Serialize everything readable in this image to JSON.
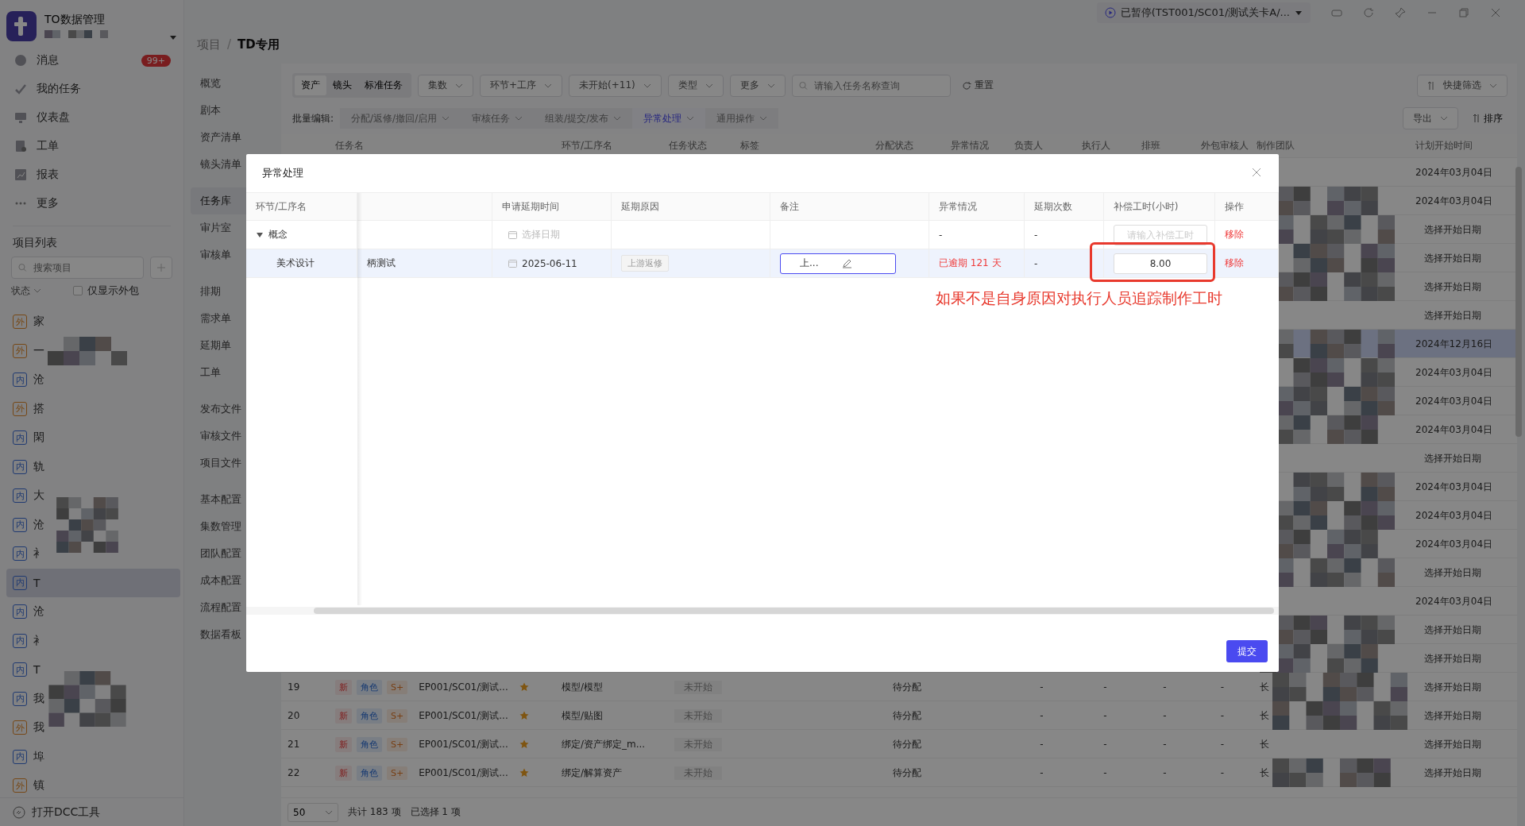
{
  "titlebar": {
    "status": "已暂停(TST001/SC01/测试关卡A/..."
  },
  "sidebar": {
    "app_name": "TO数据管理",
    "menu": [
      {
        "label": "消息",
        "badge": "99+"
      },
      {
        "label": "我的任务"
      },
      {
        "label": "仪表盘"
      },
      {
        "label": "工单"
      },
      {
        "label": "报表"
      },
      {
        "label": "更多"
      }
    ],
    "project_list": {
      "title": "项目列表",
      "search_placeholder": "搜索项目",
      "status_filter": "状态",
      "outsource_only": {
        "label": "仅显示外包",
        "checked": false
      },
      "projects": [
        {
          "tag": "外",
          "kind": "external",
          "name": "家",
          "selected": false
        },
        {
          "tag": "外",
          "kind": "external",
          "name": "一",
          "selected": false
        },
        {
          "tag": "内",
          "kind": "internal",
          "name": "沧",
          "selected": false
        },
        {
          "tag": "外",
          "kind": "external",
          "name": "搭",
          "selected": false
        },
        {
          "tag": "内",
          "kind": "internal",
          "name": "閑",
          "selected": false
        },
        {
          "tag": "内",
          "kind": "internal",
          "name": "轨",
          "selected": false
        },
        {
          "tag": "内",
          "kind": "internal",
          "name": "大",
          "selected": false
        },
        {
          "tag": "内",
          "kind": "internal",
          "name": "沧",
          "selected": false
        },
        {
          "tag": "内",
          "kind": "internal",
          "name": "衤",
          "selected": false
        },
        {
          "tag": "内",
          "kind": "internal",
          "name": "T",
          "selected": true
        },
        {
          "tag": "内",
          "kind": "internal",
          "name": "沧",
          "selected": false
        },
        {
          "tag": "内",
          "kind": "internal",
          "name": "衤",
          "selected": false
        },
        {
          "tag": "内",
          "kind": "internal",
          "name": "T",
          "selected": false
        },
        {
          "tag": "内",
          "kind": "internal",
          "name": "我",
          "selected": false
        },
        {
          "tag": "外",
          "kind": "external",
          "name": "我",
          "selected": false
        },
        {
          "tag": "内",
          "kind": "internal",
          "name": "埠",
          "selected": false
        },
        {
          "tag": "外",
          "kind": "external",
          "name": "镇",
          "selected": false
        }
      ]
    },
    "footer_link": "打开DCC工具"
  },
  "breadcrumb": {
    "items": [
      "项目",
      "TD专用"
    ],
    "separator": "/"
  },
  "nav_groups": [
    [
      {
        "label": "概览",
        "selected": false
      },
      {
        "label": "剧本",
        "selected": false
      },
      {
        "label": "资产清单",
        "selected": false
      },
      {
        "label": "镜头清单",
        "selected": false
      }
    ],
    [
      {
        "label": "任务库",
        "selected": true
      },
      {
        "label": "审片室",
        "selected": false
      },
      {
        "label": "审核单",
        "selected": false
      }
    ],
    [
      {
        "label": "排期",
        "selected": false
      },
      {
        "label": "需求单",
        "selected": false
      },
      {
        "label": "延期单",
        "selected": false
      },
      {
        "label": "工单",
        "selected": false
      }
    ],
    [
      {
        "label": "发布文件",
        "selected": false
      },
      {
        "label": "审核文件",
        "selected": false
      },
      {
        "label": "项目文件",
        "selected": false
      }
    ],
    [
      {
        "label": "基本配置",
        "selected": false
      },
      {
        "label": "集数管理",
        "selected": false
      },
      {
        "label": "团队配置",
        "selected": false
      },
      {
        "label": "成本配置",
        "selected": false
      },
      {
        "label": "流程配置",
        "selected": false
      },
      {
        "label": "数据看板",
        "selected": false
      }
    ]
  ],
  "toolbar": {
    "segments": [
      {
        "label": "资产",
        "selected": true
      },
      {
        "label": "镜头",
        "selected": false
      },
      {
        "label": "标准任务",
        "selected": false
      }
    ],
    "filters": [
      "集数",
      "环节+工序",
      "未开始(+11)",
      "类型",
      "更多"
    ],
    "search_placeholder": "请输入任务名称查询",
    "reset": "重置",
    "quick_filter": "快捷筛选"
  },
  "batch_bar": {
    "label": "批量编辑:",
    "actions": [
      {
        "label": "分配/返修/撤回/启用",
        "selected": false
      },
      {
        "label": "审核任务",
        "selected": false
      },
      {
        "label": "组装/提交/发布",
        "selected": false
      },
      {
        "label": "异常处理",
        "selected": true
      },
      {
        "label": "通用操作",
        "selected": false
      }
    ],
    "export": "导出",
    "sort": "排序"
  },
  "table": {
    "columns": [
      "",
      "任务名",
      "环节/工序名",
      "任务状态",
      "标签",
      "分配状态",
      "异常情况",
      "负责人",
      "执行人",
      "排班",
      "外包审核人",
      "制作团队",
      "计划开始时间"
    ],
    "rows": [
      {
        "selected": false,
        "plan_start": "2024年03月04日"
      },
      {
        "selected": false,
        "plan_start": "2024年03月04日"
      },
      {
        "selected": false,
        "plan_start": "选择开始日期"
      },
      {
        "selected": false,
        "plan_start": "选择开始日期"
      },
      {
        "selected": false,
        "plan_start": "选择开始日期"
      },
      {
        "selected": false,
        "plan_start": "选择开始日期"
      },
      {
        "selected": true,
        "plan_start": "2024年12月16日"
      },
      {
        "selected": false,
        "plan_start": "2024年03月04日"
      },
      {
        "selected": false,
        "plan_start": "2024年03月04日"
      },
      {
        "selected": false,
        "plan_start": "2024年03月04日"
      },
      {
        "selected": false,
        "plan_start": "选择开始日期"
      },
      {
        "selected": false,
        "plan_start": "2024年03月04日"
      },
      {
        "selected": false,
        "plan_start": "2024年03月04日"
      },
      {
        "selected": false,
        "plan_start": "2024年03月04日"
      },
      {
        "selected": false,
        "plan_start": "选择开始日期"
      },
      {
        "selected": false,
        "plan_start": "2024年03月04日"
      },
      {
        "selected": false,
        "plan_start": "选择开始日期"
      },
      {
        "selected": false,
        "plan_start": "选择开始日期"
      },
      {
        "selected": false,
        "index": "19",
        "new": "新",
        "type": "角色",
        "grade": "S+",
        "task": "EP001/SC01/测试...",
        "starred": true,
        "step": "模型/模型",
        "status": "未开始",
        "assign": "待分配",
        "abnormal": "",
        "owner": "-",
        "executor": "-",
        "schedule": "-",
        "outsource": "-",
        "team": "长",
        "plan_start": "选择开始日期"
      },
      {
        "selected": false,
        "index": "20",
        "new": "新",
        "type": "角色",
        "grade": "S+",
        "task": "EP001/SC01/测试...",
        "starred": true,
        "step": "模型/贴图",
        "status": "未开始",
        "assign": "待分配",
        "owner": "-",
        "executor": "-",
        "schedule": "-",
        "outsource": "-",
        "team": "长",
        "plan_start": "选择开始日期"
      },
      {
        "selected": false,
        "index": "21",
        "new": "新",
        "type": "角色",
        "grade": "S+",
        "task": "EP001/SC01/测试...",
        "starred": true,
        "step": "绑定/资产绑定_m...",
        "status": "未开始",
        "assign": "待分配",
        "owner": "-",
        "executor": "-",
        "schedule": "-",
        "outsource": "-",
        "team": "长",
        "plan_start": "选择开始日期"
      },
      {
        "selected": false,
        "index": "22",
        "new": "新",
        "type": "角色",
        "grade": "S+",
        "task": "EP001/SC01/测试...",
        "starred": true,
        "step": "绑定/解算资产",
        "status": "未开始",
        "assign": "待分配",
        "owner": "-",
        "executor": "-",
        "schedule": "-",
        "outsource": "-",
        "team": "长",
        "plan_start": "选择开始日期"
      }
    ]
  },
  "pagination": {
    "page_size": "50",
    "total": "共计 183 项",
    "selected_count": "已选择 1 项"
  },
  "dialog": {
    "title": "异常处理",
    "columns": [
      "环节/工序名",
      "",
      "申请延期时间",
      "延期原因",
      "备注",
      "异常情况",
      "延期次数",
      "补偿工时(小时)",
      "操作"
    ],
    "rows": [
      {
        "name": "概念",
        "expanded": true,
        "selected": false,
        "date_placeholder": "选择日期",
        "abnormal": "-",
        "delay_count": "-",
        "hours_placeholder": "请输入补偿工时",
        "action": "移除",
        "children": [
          {
            "name": "美术设计",
            "task": "柄测试",
            "selected": true,
            "date": "2025-06-11",
            "reason": "上游返修",
            "note": "上...",
            "abnormal": "已逾期 121 天",
            "overdue": true,
            "delay_count": "-",
            "hours": "8.00",
            "action": "移除"
          }
        ]
      }
    ],
    "annotation": "如果不是自身原因对执行人员追踪制作工时",
    "submit": "提交"
  }
}
